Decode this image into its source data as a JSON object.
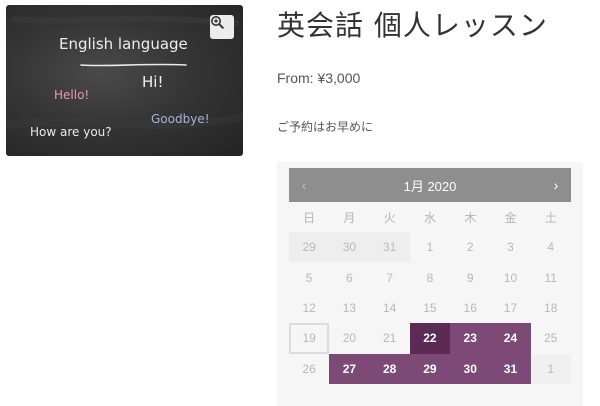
{
  "product": {
    "title": "英会話 個人レッスン",
    "price": "From: ¥3,000",
    "short_description": "ご予約はお早めに"
  },
  "image": {
    "chalk_texts": [
      "English language",
      "Hi!",
      "Hello!",
      "Goodbye!",
      "How are you?"
    ],
    "zoom_icon": "magnifier-plus-icon"
  },
  "calendar": {
    "month_label": "1月 2020",
    "prev_label": "‹",
    "next_label": "›",
    "weekdays": [
      "日",
      "月",
      "火",
      "水",
      "木",
      "金",
      "土"
    ],
    "days": [
      {
        "label": "29",
        "state": "other"
      },
      {
        "label": "30",
        "state": "other"
      },
      {
        "label": "31",
        "state": "other"
      },
      {
        "label": "1",
        "state": "past"
      },
      {
        "label": "2",
        "state": "past"
      },
      {
        "label": "3",
        "state": "past"
      },
      {
        "label": "4",
        "state": "past"
      },
      {
        "label": "5",
        "state": "past"
      },
      {
        "label": "6",
        "state": "past"
      },
      {
        "label": "7",
        "state": "past"
      },
      {
        "label": "8",
        "state": "past"
      },
      {
        "label": "9",
        "state": "past"
      },
      {
        "label": "10",
        "state": "past"
      },
      {
        "label": "11",
        "state": "past"
      },
      {
        "label": "12",
        "state": "past"
      },
      {
        "label": "13",
        "state": "past"
      },
      {
        "label": "14",
        "state": "past"
      },
      {
        "label": "15",
        "state": "past"
      },
      {
        "label": "16",
        "state": "past"
      },
      {
        "label": "17",
        "state": "past"
      },
      {
        "label": "18",
        "state": "past"
      },
      {
        "label": "19",
        "state": "today"
      },
      {
        "label": "20",
        "state": "past"
      },
      {
        "label": "21",
        "state": "past"
      },
      {
        "label": "22",
        "state": "bookable selected"
      },
      {
        "label": "23",
        "state": "bookable"
      },
      {
        "label": "24",
        "state": "bookable"
      },
      {
        "label": "25",
        "state": "past"
      },
      {
        "label": "26",
        "state": "past"
      },
      {
        "label": "27",
        "state": "bookable"
      },
      {
        "label": "28",
        "state": "bookable"
      },
      {
        "label": "29",
        "state": "bookable"
      },
      {
        "label": "30",
        "state": "bookable"
      },
      {
        "label": "31",
        "state": "bookable"
      },
      {
        "label": "1",
        "state": "next-other"
      }
    ]
  },
  "colors": {
    "header_bg": "#8e8e8e",
    "bookable": "#7d4a77",
    "selected": "#5b2b56"
  }
}
